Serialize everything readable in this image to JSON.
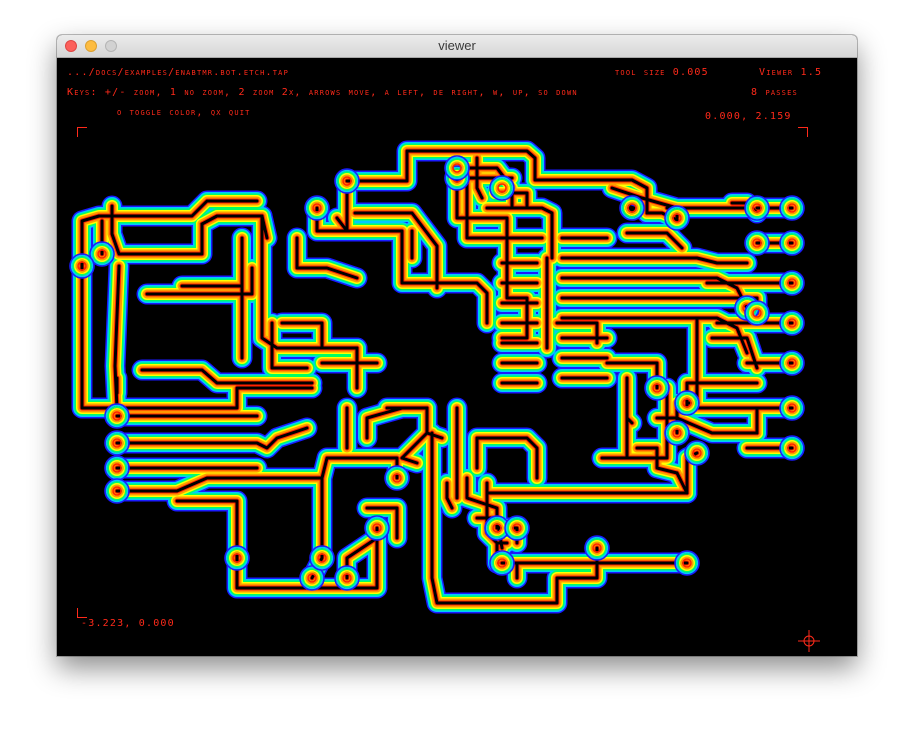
{
  "window": {
    "title": "viewer"
  },
  "hud": {
    "file_path": ".../docs/examples/enabtmr.bot.etch.tap",
    "tool_size": "tool size  0.005",
    "viewer_version": "Viewer 1.5",
    "keys_line": "Keys: +/- zoom, 1 no zoom, 2 zoom 2x, arrows move, a left, de right, w, up, so down",
    "passes": "8 passes",
    "keys_line2": "o toggle color, qx quit",
    "coord_top_right": "0.000,  2.159",
    "coord_bottom_left": "-3.223,  0.000"
  },
  "colors": {
    "hud_text": "#ff2a1a",
    "background": "#000000",
    "pass_colors": [
      "#1a1aff",
      "#00c8ff",
      "#00ff66",
      "#ffff00",
      "#ff9900",
      "#ff2200"
    ]
  },
  "icons": {
    "crosshair": "crosshair-icon"
  }
}
